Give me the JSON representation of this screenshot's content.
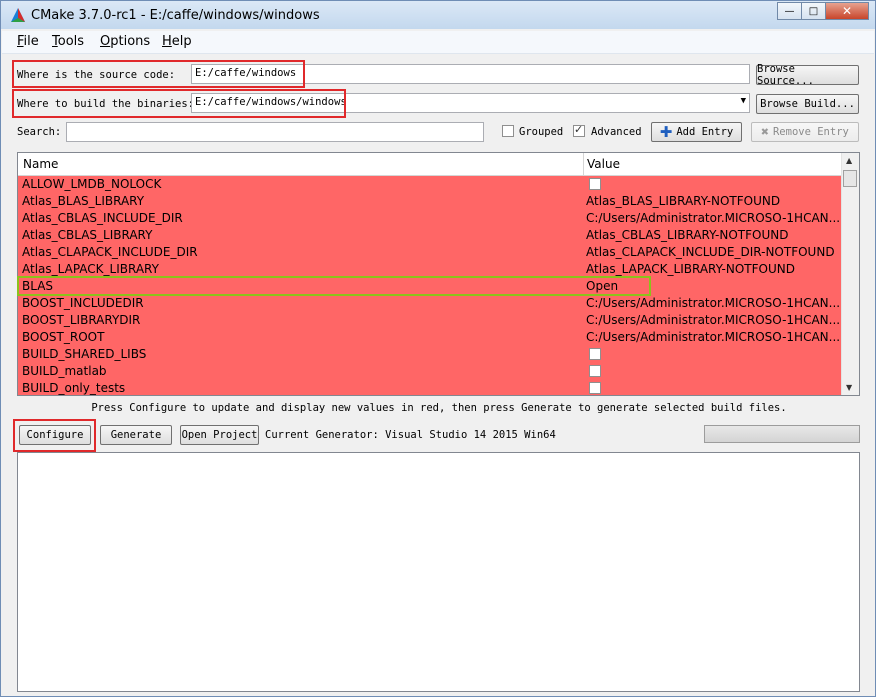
{
  "window": {
    "title": "CMake 3.7.0-rc1 - E:/caffe/windows/windows"
  },
  "menu": [
    "File",
    "Tools",
    "Options",
    "Help"
  ],
  "source": {
    "label": "Where is the source code:",
    "value": "E:/caffe/windows",
    "browse": "Browse Source..."
  },
  "binaries": {
    "label": "Where to build the binaries:",
    "value": "E:/caffe/windows/windows",
    "browse": "Browse Build..."
  },
  "search": {
    "label": "Search:",
    "value": ""
  },
  "options": {
    "grouped": {
      "label": "Grouped",
      "checked": false
    },
    "advanced": {
      "label": "Advanced",
      "checked": true
    }
  },
  "add_entry": "Add Entry",
  "remove_entry": "Remove Entry",
  "table": {
    "columns": [
      "Name",
      "Value"
    ],
    "rows": [
      {
        "name": "ALLOW_LMDB_NOLOCK",
        "value": "",
        "checkbox": true
      },
      {
        "name": "Atlas_BLAS_LIBRARY",
        "value": "Atlas_BLAS_LIBRARY-NOTFOUND"
      },
      {
        "name": "Atlas_CBLAS_INCLUDE_DIR",
        "value": "C:/Users/Administrator.MICROSO-1HCAN..."
      },
      {
        "name": "Atlas_CBLAS_LIBRARY",
        "value": "Atlas_CBLAS_LIBRARY-NOTFOUND"
      },
      {
        "name": "Atlas_CLAPACK_INCLUDE_DIR",
        "value": "Atlas_CLAPACK_INCLUDE_DIR-NOTFOUND"
      },
      {
        "name": "Atlas_LAPACK_LIBRARY",
        "value": "Atlas_LAPACK_LIBRARY-NOTFOUND"
      },
      {
        "name": "BLAS",
        "value": "Open"
      },
      {
        "name": "BOOST_INCLUDEDIR",
        "value": "C:/Users/Administrator.MICROSO-1HCAN..."
      },
      {
        "name": "BOOST_LIBRARYDIR",
        "value": "C:/Users/Administrator.MICROSO-1HCAN..."
      },
      {
        "name": "BOOST_ROOT",
        "value": "C:/Users/Administrator.MICROSO-1HCAN..."
      },
      {
        "name": "BUILD_SHARED_LIBS",
        "value": "",
        "checkbox": true
      },
      {
        "name": "BUILD_matlab",
        "value": "",
        "checkbox": true
      },
      {
        "name": "BUILD_only_tests",
        "value": "",
        "checkbox": true
      }
    ]
  },
  "hint": "Press Configure to update and display new values in red, then press Generate to generate selected build files.",
  "buttons": {
    "configure": "Configure",
    "generate": "Generate",
    "open_project": "Open Project"
  },
  "generator": "Current Generator: Visual Studio 14 2015 Win64",
  "colors": {
    "changed_row": "#ff6666",
    "highlight_red": "#e0292b",
    "highlight_green": "#8cc21b"
  }
}
